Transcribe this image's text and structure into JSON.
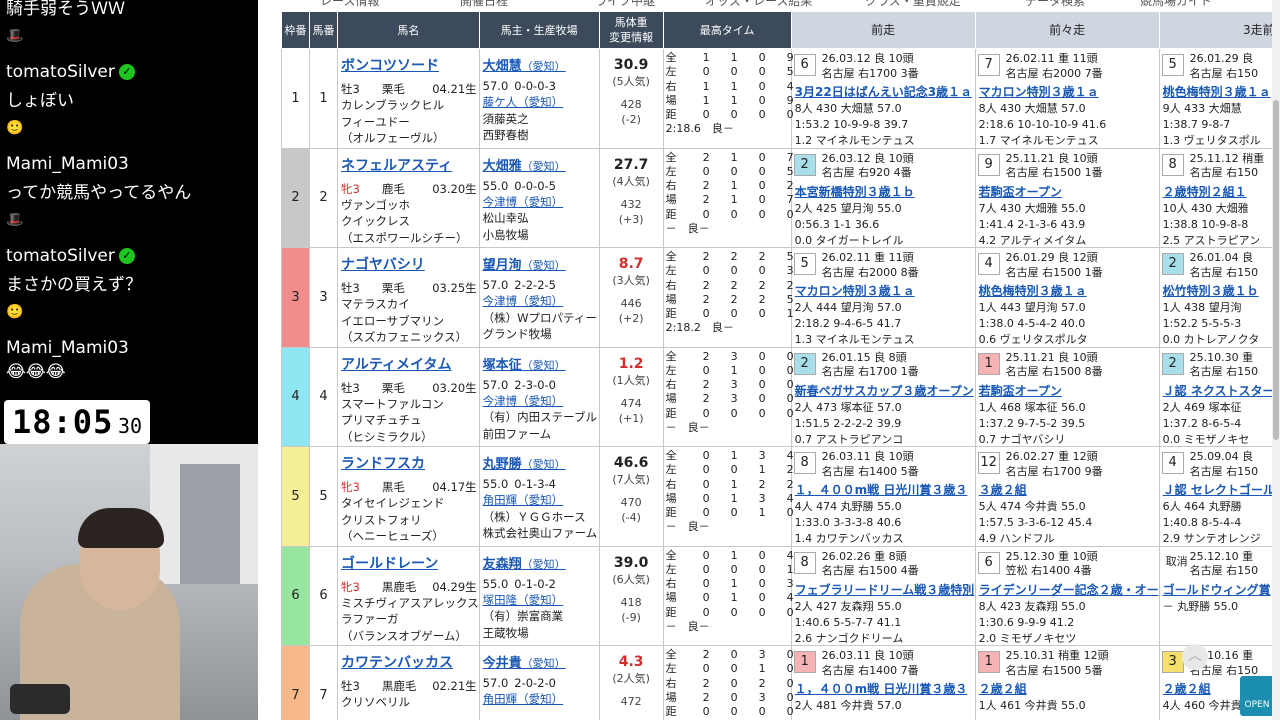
{
  "chat": {
    "top_line": "騎手弱そうＷＷ",
    "messages": [
      {
        "user": "tomatoSilver",
        "verified": true,
        "text": "しょぼい"
      },
      {
        "user": "Mami_Mami03",
        "verified": false,
        "text": "ってか競馬やってるやん"
      },
      {
        "user": "tomatoSilver",
        "verified": true,
        "text": "まさかの買えず？"
      },
      {
        "user": "Mami_Mami03",
        "verified": false,
        "text": "😂😂😂"
      }
    ],
    "clock": {
      "hm": "18:05",
      "sec": "30"
    }
  },
  "nav": [
    "レース情報",
    "開催日程",
    "ライブ中継",
    "オッズ・レース結果",
    "クラス・重賞競走",
    "データ検索",
    "競馬場ガイド"
  ],
  "headers": {
    "waku": "枠番",
    "uma": "馬番",
    "horse": "馬名",
    "owner": "馬主・生産牧場",
    "weight": "馬体重\n変更情報",
    "time": "最高タイム",
    "prev1": "前走",
    "prev2": "前々走",
    "prev3": "3走前"
  },
  "colors": {
    "header_bg": "#3c4a5c",
    "prev_header_bg": "#cfd6df",
    "link": "#1a58b5",
    "accent_red": "#d32e2e"
  },
  "rows": [
    {
      "waku": "1",
      "uma": "1",
      "waku_color": "#ffffff",
      "horse": "ボンコツソード",
      "sex": "牡3",
      "coat": "栗毛",
      "dob": "04.21生",
      "sire": "カレンブラックヒル",
      "dam": "フィーユドー",
      "damsire": "（オルフェーヴル）",
      "jockey": "大畑慧",
      "jockey_area": "（愛知）",
      "weight_kg": "57.0",
      "record": "0-0-0-3",
      "trainer": "藤ケ人（愛知）",
      "owner": "須藤英之",
      "breeder": "西野春樹",
      "odds": "30.9",
      "pop": "(5人気)",
      "bw": "428",
      "bwc": "(-2)",
      "odds_red": false,
      "recs": [
        [
          "全",
          "1",
          "1",
          "0",
          "9"
        ],
        [
          "左",
          "0",
          "0",
          "0",
          "5"
        ],
        [
          "右",
          "1",
          "1",
          "0",
          "4"
        ],
        [
          "場",
          "1",
          "1",
          "0",
          "9"
        ],
        [
          "距",
          "0",
          "0",
          "0",
          "0"
        ]
      ],
      "besttime": "2:18.6　良－",
      "prev": [
        {
          "pos": "6",
          "pclass": "",
          "date": "26.03.12 良 10頭",
          "course": "名古屋 右1700 3番",
          "title": "3月22日はばんえい記念3歳１ａ",
          "l1": "8人 430 大畑慧 57.0",
          "l2": "1:53.2 10-9-9-8 39.7",
          "l3": "1.2 マイネルモンテュス"
        },
        {
          "pos": "7",
          "pclass": "",
          "date": "26.02.11 重 11頭",
          "course": "名古屋 右2000 7番",
          "title": "マカロン特別３歳１ａ",
          "l1": "8人 430 大畑慧 57.0",
          "l2": "2:18.6 10-10-10-9 41.6",
          "l3": "1.7 マイネルモンテュス"
        },
        {
          "pos": "5",
          "pclass": "",
          "date": "26.01.29 良",
          "course": "名古屋 右150",
          "title": "桃色梅特別３歳１ａ",
          "l1": "9人 433 大畑慧",
          "l2": "1:38.7 9-8-7",
          "l3": "1.3 ヴェリタスポル"
        }
      ]
    },
    {
      "waku": "2",
      "uma": "2",
      "waku_color": "#c8c8c8",
      "horse": "ネフェルアスティ",
      "sex": "牝3",
      "coat": "鹿毛",
      "dob": "03.20生",
      "sire": "ヴァンゴッホ",
      "dam": "クイックレス",
      "damsire": "（エスポワールシチー）",
      "jockey": "大畑雅",
      "jockey_area": "（愛知）",
      "weight_kg": "55.0",
      "record": "0-0-0-5",
      "trainer": "今津博（愛知）",
      "owner": "松山幸弘",
      "breeder": "小島牧場",
      "odds": "27.7",
      "pop": "(4人気)",
      "bw": "432",
      "bwc": "(+3)",
      "odds_red": false,
      "recs": [
        [
          "全",
          "2",
          "1",
          "0",
          "7"
        ],
        [
          "左",
          "0",
          "0",
          "0",
          "5"
        ],
        [
          "右",
          "2",
          "1",
          "0",
          "2"
        ],
        [
          "場",
          "2",
          "1",
          "0",
          "7"
        ],
        [
          "距",
          "0",
          "0",
          "0",
          "0"
        ]
      ],
      "besttime": "－　良－",
      "prev": [
        {
          "pos": "2",
          "pclass": "p2",
          "date": "26.03.12 良 10頭",
          "course": "名古屋 右920 4番",
          "title": "本宮新橋特別３歳１ｂ",
          "l1": "2人 425 望月洵 55.0",
          "l2": "0:56.3 1-1 36.6",
          "l3": "0.0 タイガートレイル"
        },
        {
          "pos": "9",
          "pclass": "",
          "date": "25.11.21 良 10頭",
          "course": "名古屋 右1500 1番",
          "title": "若駒盃オープン",
          "l1": "7人 430 大畑雅 55.0",
          "l2": "1:41.4 2-1-3-6 43.9",
          "l3": "4.2 アルティメイタム"
        },
        {
          "pos": "8",
          "pclass": "",
          "date": "25.11.12 稍重",
          "course": "名古屋 右150",
          "title": "２歳特別２組１",
          "l1": "10人 430 大畑雅",
          "l2": "1:38.8 10-9-8-8",
          "l3": "2.5 アストラピアン"
        }
      ]
    },
    {
      "waku": "3",
      "uma": "3",
      "waku_color": "#f08c8c",
      "horse": "ナゴヤバシリ",
      "sex": "牡3",
      "coat": "栗毛",
      "dob": "03.25生",
      "sire": "マテラスカイ",
      "dam": "イエローサブマリン",
      "damsire": "（スズカフェニックス）",
      "jockey": "望月洵",
      "jockey_area": "（愛知）",
      "weight_kg": "57.0",
      "record": "2-2-2-5",
      "trainer": "今津博（愛知）",
      "owner": "（株）Wプロパティー",
      "breeder": "グランド牧場",
      "odds": "8.7",
      "pop": "(3人気)",
      "bw": "446",
      "bwc": "(+2)",
      "odds_red": true,
      "recs": [
        [
          "全",
          "2",
          "2",
          "2",
          "5"
        ],
        [
          "左",
          "0",
          "0",
          "0",
          "3"
        ],
        [
          "右",
          "2",
          "2",
          "2",
          "2"
        ],
        [
          "場",
          "2",
          "2",
          "2",
          "5"
        ],
        [
          "距",
          "0",
          "0",
          "0",
          "1"
        ]
      ],
      "besttime": "2:18.2　良－",
      "prev": [
        {
          "pos": "5",
          "pclass": "",
          "date": "26.02.11 重 11頭",
          "course": "名古屋 右2000 8番",
          "title": "マカロン特別３歳１ａ",
          "l1": "2人 444 望月洵 57.0",
          "l2": "2:18.2 9-4-6-5 41.7",
          "l3": "1.3 マイネルモンテュス"
        },
        {
          "pos": "4",
          "pclass": "",
          "date": "26.01.29 良 12頭",
          "course": "名古屋 右1500 1番",
          "title": "桃色梅特別３歳１ａ",
          "l1": "1人 443 望月洵 57.0",
          "l2": "1:38.0 4-5-4-2 40.0",
          "l3": "0.6 ヴェリタスポルタ"
        },
        {
          "pos": "2",
          "pclass": "p2",
          "date": "26.01.04 良",
          "course": "名古屋 右150",
          "title": "松竹特別３歳１ｂ",
          "l1": "1人 438 望月洵",
          "l2": "1:52.2 5-5-5-3",
          "l3": "0.0 カトレアノクタ"
        }
      ]
    },
    {
      "waku": "4",
      "uma": "4",
      "waku_color": "#8ee6f2",
      "horse": "アルティメイタム",
      "sex": "牡3",
      "coat": "栗毛",
      "dob": "03.20生",
      "sire": "スマートファルコン",
      "dam": "プリマチュチュ",
      "damsire": "（ヒシミラクル）",
      "jockey": "塚本征",
      "jockey_area": "（愛知）",
      "weight_kg": "57.0",
      "record": "2-3-0-0",
      "trainer": "今津博（愛知）",
      "owner": "（有）内田ステーブル",
      "breeder": "前田ファーム",
      "odds": "1.2",
      "pop": "(1人気)",
      "bw": "474",
      "bwc": "(+1)",
      "odds_red": true,
      "recs": [
        [
          "全",
          "2",
          "3",
          "0",
          "0"
        ],
        [
          "左",
          "0",
          "1",
          "0",
          "0"
        ],
        [
          "右",
          "2",
          "3",
          "0",
          "0"
        ],
        [
          "場",
          "2",
          "3",
          "0",
          "0"
        ],
        [
          "距",
          "0",
          "0",
          "0",
          "0"
        ]
      ],
      "besttime": "－　良－",
      "prev": [
        {
          "pos": "2",
          "pclass": "p2",
          "date": "26.01.15 良 8頭",
          "course": "名古屋 右1700 1番",
          "title": "新春ペガサスカップ３歳オープン",
          "l1": "2人 473 塚本征 57.0",
          "l2": "1:51.5 2-2-2-2 39.9",
          "l3": "0.7 アストラピアンコ"
        },
        {
          "pos": "1",
          "pclass": "p1",
          "date": "25.11.21 良 10頭",
          "course": "名古屋 右1500 8番",
          "title": "若駒盃オープン",
          "l1": "1人 468 塚本征 56.0",
          "l2": "1:37.2 9-7-5-2 39.5",
          "l3": "0.7 ナゴヤバシリ"
        },
        {
          "pos": "2",
          "pclass": "p2",
          "date": "25.10.30 重",
          "course": "名古屋 右150",
          "title": "Ｊ認 ネクストスター",
          "l1": "2人 469 塚本征",
          "l2": "1:37.2 8-6-5-4",
          "l3": "0.0 ミモザノキセ"
        }
      ]
    },
    {
      "waku": "5",
      "uma": "5",
      "waku_color": "#f5f096",
      "horse": "ランドフスカ",
      "sex": "牝3",
      "coat": "黒毛",
      "dob": "04.17生",
      "sire": "タイセイレジェンド",
      "dam": "クリストフォリ",
      "damsire": "（ヘニーヒューズ）",
      "jockey": "丸野勝",
      "jockey_area": "（愛知）",
      "weight_kg": "55.0",
      "record": "0-1-3-4",
      "trainer": "角田輝（愛知）",
      "owner": "（株）ＹＧＧホース",
      "breeder": "株式会社奥山ファーム",
      "odds": "46.6",
      "pop": "(7人気)",
      "bw": "470",
      "bwc": "(-4)",
      "odds_red": false,
      "recs": [
        [
          "全",
          "0",
          "1",
          "3",
          "4"
        ],
        [
          "左",
          "0",
          "0",
          "1",
          "2"
        ],
        [
          "右",
          "0",
          "1",
          "2",
          "2"
        ],
        [
          "場",
          "0",
          "1",
          "3",
          "4"
        ],
        [
          "距",
          "0",
          "0",
          "1",
          "0"
        ]
      ],
      "besttime": "－　良－",
      "prev": [
        {
          "pos": "8",
          "pclass": "",
          "date": "26.03.11 良 10頭",
          "course": "名古屋 右1400 5番",
          "title": "１，４００m戦 日光川賞３歳３",
          "l1": "4人 474 丸野勝 55.0",
          "l2": "1:33.0 3-3-3-8 40.6",
          "l3": "1.4 カワテンバッカス"
        },
        {
          "pos": "12",
          "pclass": "",
          "date": "26.02.27 重 12頭",
          "course": "名古屋 右1700 9番",
          "title": "３歳２組",
          "l1": "5人 474 今井貴 55.0",
          "l2": "1:57.5 3-3-6-12 45.4",
          "l3": "4.9 ハンドフル"
        },
        {
          "pos": "4",
          "pclass": "",
          "date": "25.09.04 良",
          "course": "名古屋 右150",
          "title": "Ｊ認 セレクトゴール",
          "l1": "6人 464 丸野勝",
          "l2": "1:40.8 8-5-4-4",
          "l3": "2.9 サンテオレンジ"
        }
      ]
    },
    {
      "waku": "6",
      "uma": "6",
      "waku_color": "#96e6a0",
      "horse": "ゴールドレーン",
      "sex": "牝3",
      "coat": "黒鹿毛",
      "dob": "04.29生",
      "sire": "ミスチヴィアスアレックス",
      "dam": "ラファーガ",
      "damsire": "（バランスオブゲーム）",
      "jockey": "友森翔",
      "jockey_area": "（愛知）",
      "weight_kg": "55.0",
      "record": "0-1-0-2",
      "trainer": "塚田隆（愛知）",
      "owner": "（有）崇富商業",
      "breeder": "王蔵牧場",
      "odds": "39.0",
      "pop": "(6人気)",
      "bw": "418",
      "bwc": "(-9)",
      "odds_red": false,
      "recs": [
        [
          "全",
          "0",
          "1",
          "0",
          "4"
        ],
        [
          "左",
          "0",
          "0",
          "0",
          "1"
        ],
        [
          "右",
          "0",
          "1",
          "0",
          "3"
        ],
        [
          "場",
          "0",
          "1",
          "0",
          "4"
        ],
        [
          "距",
          "0",
          "0",
          "0",
          "0"
        ]
      ],
      "besttime": "－　良－",
      "prev": [
        {
          "pos": "8",
          "pclass": "",
          "date": "26.02.26 重 8頭",
          "course": "名古屋 右1500 4番",
          "title": "フェブラリードリーム戦３歳特別",
          "l1": "2人 427 友森翔 55.0",
          "l2": "1:40.6 5-5-7-7 41.1",
          "l3": "2.6 ナンゴクドリーム"
        },
        {
          "pos": "6",
          "pclass": "",
          "date": "25.12.30 重 10頭",
          "course": "笠松 右1400 4番",
          "title": "ライデンリーダー記念２歳・オー",
          "l1": "8人 423 友森翔 55.0",
          "l2": "1:30.6 9-9-9 41.2",
          "l3": "2.0 ミモザノキセツ"
        },
        {
          "pos": "取消",
          "pclass": "pt",
          "date": "25.12.10 重",
          "course": "名古屋 右150",
          "title": "ゴールドウィング賞",
          "l1": "－ 丸野勝 55.0",
          "l2": "",
          "l3": ""
        }
      ]
    },
    {
      "waku": "7",
      "uma": "7",
      "waku_color": "#f7b98a",
      "horse": "カワテンバッカス",
      "sex": "牡3",
      "coat": "黒鹿毛",
      "dob": "02.21生",
      "sire": "クリソベリル",
      "dam": "",
      "damsire": "",
      "jockey": "今井貴",
      "jockey_area": "（愛知）",
      "weight_kg": "57.0",
      "record": "2-0-2-0",
      "trainer": "角田輝（愛知）",
      "owner": "",
      "breeder": "",
      "odds": "4.3",
      "pop": "(2人気)",
      "bw": "472",
      "bwc": "",
      "odds_red": true,
      "recs": [
        [
          "全",
          "2",
          "0",
          "3",
          "0"
        ],
        [
          "左",
          "0",
          "0",
          "1",
          "0"
        ],
        [
          "右",
          "2",
          "0",
          "2",
          "0"
        ],
        [
          "場",
          "2",
          "0",
          "3",
          "0"
        ],
        [
          "距",
          "0",
          "0",
          "0",
          "0"
        ]
      ],
      "besttime": "",
      "prev": [
        {
          "pos": "1",
          "pclass": "p1",
          "date": "26.03.11 良 10頭",
          "course": "名古屋 右1400 7番",
          "title": "１，４００m戦 日光川賞３歳３",
          "l1": "2人 481 今井貴 57.0",
          "l2": "",
          "l3": ""
        },
        {
          "pos": "1",
          "pclass": "p1",
          "date": "25.10.31 稍重 12頭",
          "course": "名古屋 右1500 5番",
          "title": "２歳２組",
          "l1": "1人 461 今井貴 55.0",
          "l2": "",
          "l3": ""
        },
        {
          "pos": "3",
          "pclass": "p3",
          "date": "25.10.16 重",
          "course": "名古屋 右150",
          "title": "２歳２組",
          "l1": "4人 460 今井貴",
          "l2": "",
          "l3": ""
        }
      ]
    }
  ],
  "badge": {
    "open": "OPEN",
    "up": "︿"
  }
}
